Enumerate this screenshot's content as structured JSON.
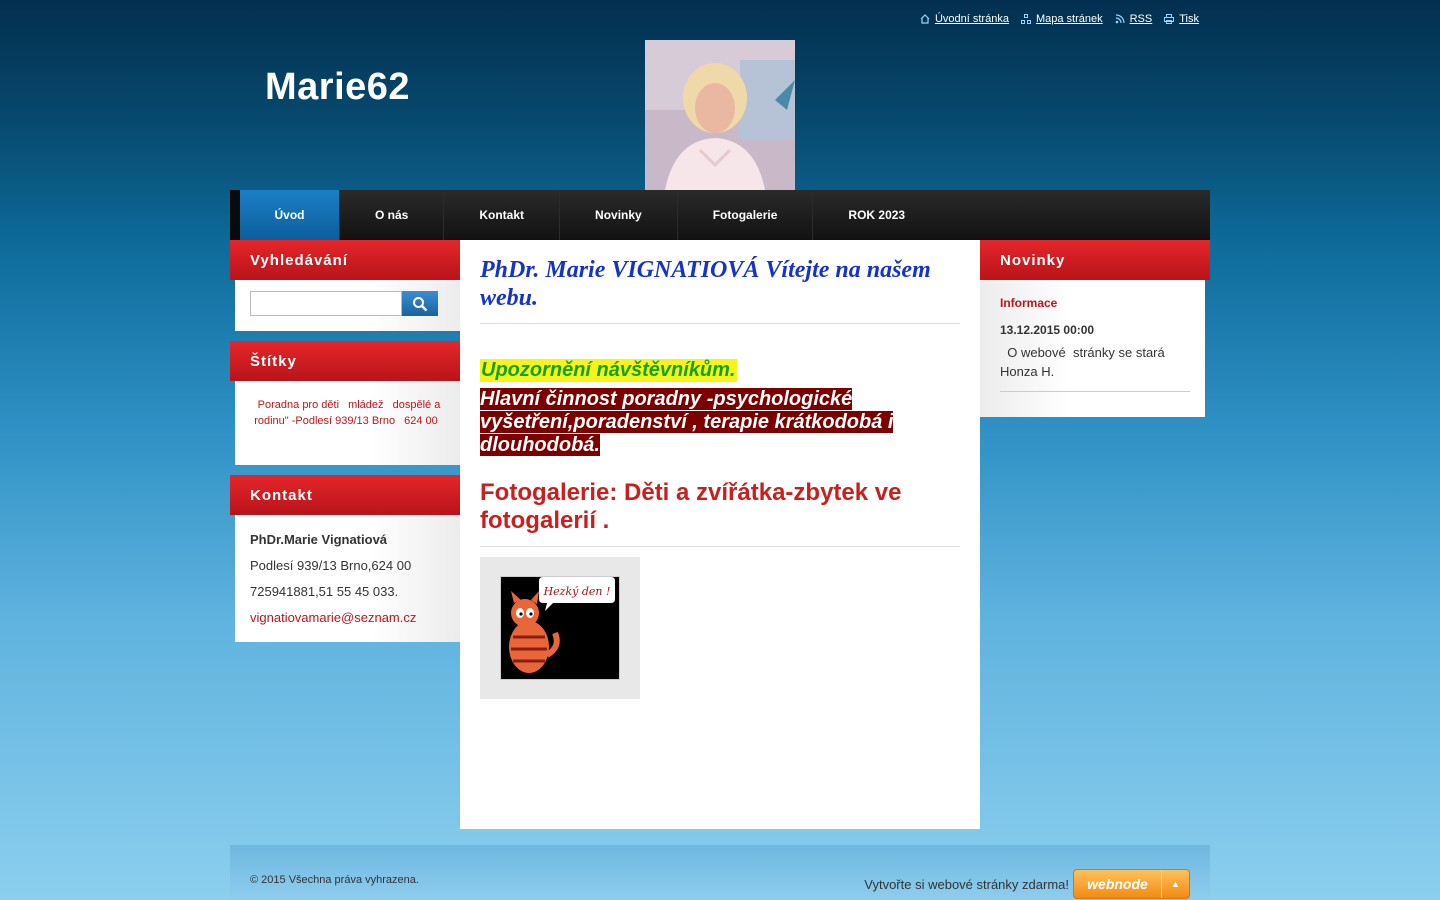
{
  "toplinks": {
    "home": "Úvodní stránka",
    "sitemap": "Mapa stránek",
    "rss": "RSS",
    "print": "Tisk"
  },
  "site": {
    "title": "Marie62"
  },
  "nav": [
    "Úvod",
    "O nás",
    "Kontakt",
    "Novinky",
    "Fotogalerie",
    "ROK 2023"
  ],
  "left": {
    "search_title": "Vyhledávání",
    "tags_title": "Štítky",
    "tags": [
      "Poradna pro děti",
      "mládež",
      "dospělé a rodinu\" -Podlesí 939/13 Brno",
      "624 00"
    ],
    "contact_title": "Kontakt",
    "contact_name": "PhDr.Marie Vignatiová",
    "contact_address": "Podlesí 939/13 Brno,624 00",
    "contact_phone": "725941881,51 55 45 033.",
    "contact_email": "vignatiovamarie@seznam.cz"
  },
  "main": {
    "heading": "PhDr. Marie  VIGNATIOVÁ Vítejte na našem webu.",
    "warning": "Upozornění návštěvníkům.",
    "activity": "Hlavní činnost poradny -psychologické vyšetření,poradenství , terapie krátkodobá i dlouhodobá.",
    "gallery_heading": "Fotogalerie: Děti a zvířátka-zbytek ve fotogalerií .",
    "gallery_image_text": "Hezký den !"
  },
  "right": {
    "title": "Novinky",
    "news_link": "Informace",
    "news_date": "13.12.2015 00:00",
    "news_text": "  O webové  stránky se stará Honza H."
  },
  "footer": {
    "copyright": "© 2015 Všechna práva vyhrazena.",
    "promo": "Vytvořte si webové stránky zdarma!",
    "brand": "webnode"
  },
  "colors": {
    "nav_active": "#1b7fc4",
    "box_header": "#d61c20",
    "heading_blue": "#1533c8",
    "gallery_red": "#c81f1f",
    "warning_bg": "#f5f51d",
    "activity_bg": "#7b0000"
  }
}
